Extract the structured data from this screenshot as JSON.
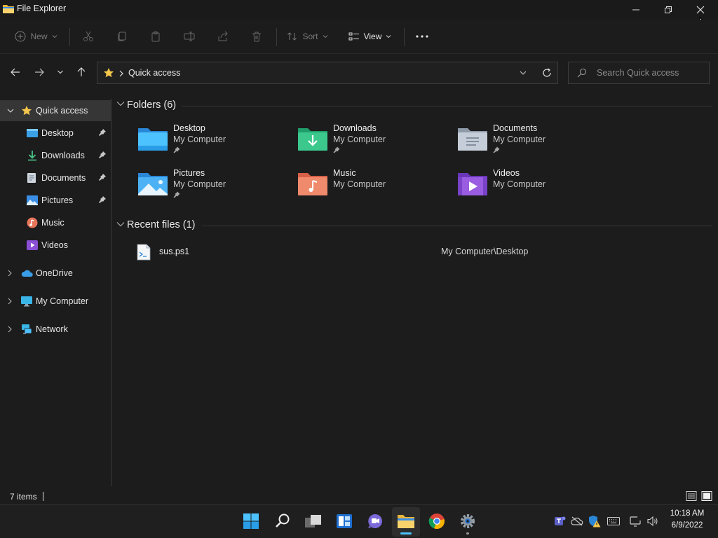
{
  "window": {
    "title": "File Explorer"
  },
  "commandbar": {
    "new_label": "New",
    "sort_label": "Sort",
    "view_label": "View"
  },
  "address": {
    "location": "Quick access"
  },
  "search": {
    "placeholder": "Search Quick access"
  },
  "sidebar": {
    "quick_access": "Quick access",
    "items": [
      {
        "label": "Desktop",
        "icon": "desktop-folder-icon",
        "pinned": true
      },
      {
        "label": "Downloads",
        "icon": "downloads-folder-icon",
        "pinned": true
      },
      {
        "label": "Documents",
        "icon": "documents-folder-icon",
        "pinned": true
      },
      {
        "label": "Pictures",
        "icon": "pictures-folder-icon",
        "pinned": true
      },
      {
        "label": "Music",
        "icon": "music-folder-icon",
        "pinned": false
      },
      {
        "label": "Videos",
        "icon": "videos-folder-icon",
        "pinned": false
      }
    ],
    "onedrive": "OneDrive",
    "my_computer": "My Computer",
    "network": "Network"
  },
  "content": {
    "folders_header": "Folders (6)",
    "folders": [
      {
        "name": "Desktop",
        "location": "My Computer",
        "pinned": true
      },
      {
        "name": "Downloads",
        "location": "My Computer",
        "pinned": true
      },
      {
        "name": "Documents",
        "location": "My Computer",
        "pinned": true
      },
      {
        "name": "Pictures",
        "location": "My Computer",
        "pinned": true
      },
      {
        "name": "Music",
        "location": "My Computer",
        "pinned": false
      },
      {
        "name": "Videos",
        "location": "My Computer",
        "pinned": false
      }
    ],
    "recent_header": "Recent files (1)",
    "recent": [
      {
        "name": "sus.ps1",
        "path": "My Computer\\Desktop"
      }
    ]
  },
  "status": {
    "item_count": "7 items"
  },
  "taskbar": {
    "time": "10:18 AM",
    "date": "6/9/2022"
  },
  "colors": {
    "background": "#1c1c1c",
    "accent_blue": "#4cc2ff",
    "folder_yellow": "#f5c84c"
  }
}
